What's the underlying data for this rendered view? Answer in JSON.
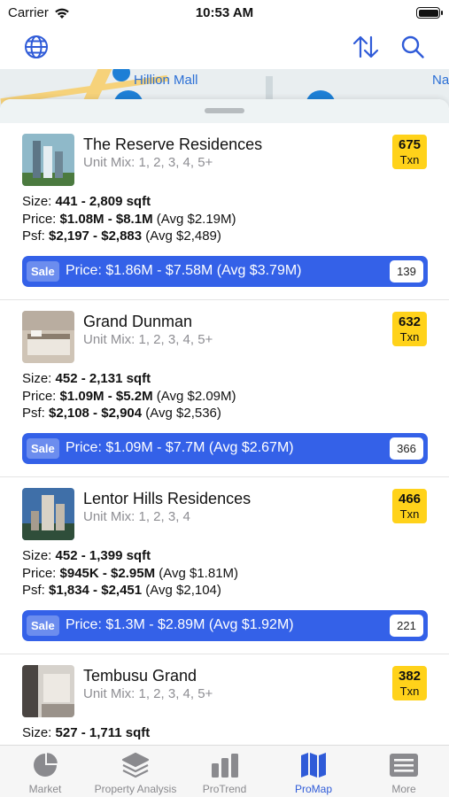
{
  "status": {
    "carrier": "Carrier",
    "time": "10:53 AM"
  },
  "nav": {
    "globe_icon": "globe-icon",
    "sort_icon": "sort-arrows-icon",
    "search_icon": "search-icon"
  },
  "map": {
    "label_left": "Hillion Mall",
    "label_right": "Na"
  },
  "listings": [
    {
      "name": "The Reserve Residences",
      "unit_mix": "Unit Mix: 1, 2, 3, 4, 5+",
      "txn_count": "675",
      "txn_label": "Txn",
      "size_label": "Size: ",
      "size_value": "441 - 2,809 sqft",
      "price_label": "Price: ",
      "price_value": "$1.08M - $8.1M",
      "price_avg": " (Avg $2.19M)",
      "psf_label": "Psf: ",
      "psf_value": "$2,197 - $2,883",
      "psf_avg": " (Avg $2,489)",
      "sale_tag": "Sale",
      "sale_text": "Price: $1.86M - $7.58M (Avg $3.79M)",
      "sale_count": "139"
    },
    {
      "name": "Grand Dunman",
      "unit_mix": "Unit Mix: 1, 2, 3, 4, 5+",
      "txn_count": "632",
      "txn_label": "Txn",
      "size_label": "Size: ",
      "size_value": "452 - 2,131 sqft",
      "price_label": "Price: ",
      "price_value": "$1.09M - $5.2M",
      "price_avg": " (Avg $2.09M)",
      "psf_label": "Psf: ",
      "psf_value": "$2,108 - $2,904",
      "psf_avg": " (Avg $2,536)",
      "sale_tag": "Sale",
      "sale_text": "Price: $1.09M - $7.7M (Avg $2.67M)",
      "sale_count": "366"
    },
    {
      "name": "Lentor Hills Residences",
      "unit_mix": "Unit Mix: 1, 2, 3, 4",
      "txn_count": "466",
      "txn_label": "Txn",
      "size_label": "Size: ",
      "size_value": "452 - 1,399 sqft",
      "price_label": "Price: ",
      "price_value": "$945K - $2.95M",
      "price_avg": " (Avg $1.81M)",
      "psf_label": "Psf: ",
      "psf_value": "$1,834 - $2,451",
      "psf_avg": " (Avg $2,104)",
      "sale_tag": "Sale",
      "sale_text": "Price: $1.3M - $2.89M (Avg $1.92M)",
      "sale_count": "221"
    },
    {
      "name": "Tembusu Grand",
      "unit_mix": "Unit Mix: 1, 2, 3, 4, 5+",
      "txn_count": "382",
      "txn_label": "Txn",
      "size_label": "Size: ",
      "size_value": "527 - 1,711 sqft"
    }
  ],
  "tabs": [
    {
      "label": "Market",
      "icon": "pie-chart-icon"
    },
    {
      "label": "Property Analysis",
      "icon": "layers-icon"
    },
    {
      "label": "ProTrend",
      "icon": "bar-chart-icon"
    },
    {
      "label": "ProMap",
      "icon": "map-icon",
      "active": true
    },
    {
      "label": "More",
      "icon": "list-icon"
    }
  ],
  "colors": {
    "accent": "#3461e8",
    "txn_badge": "#ffd21a",
    "tab_active": "#2f5bd8"
  }
}
